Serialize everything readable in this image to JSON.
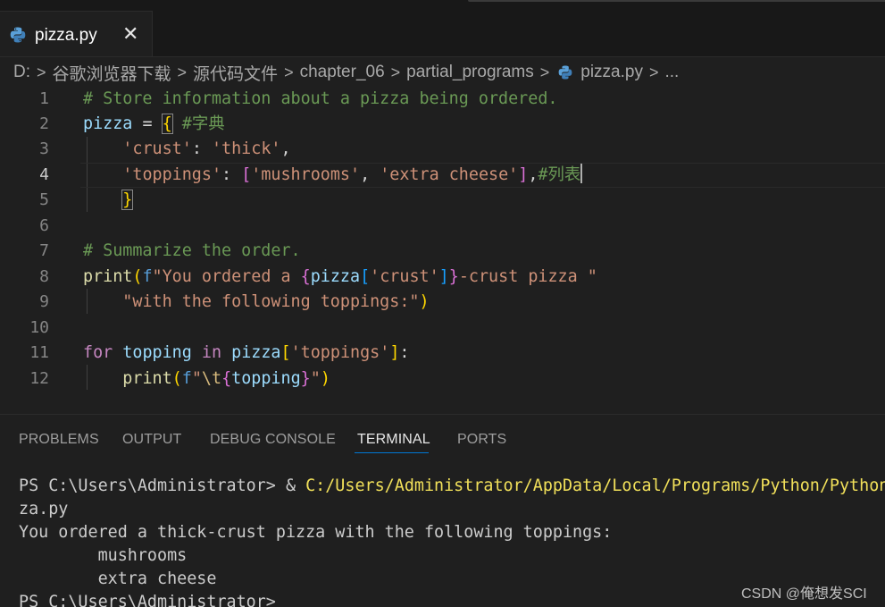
{
  "tab": {
    "title": "pizza.py",
    "close_glyph": "✕",
    "icon": "python-icon"
  },
  "breadcrumb": {
    "items": [
      "D:",
      "谷歌浏览器下载",
      "源代码文件",
      "chapter_06",
      "partial_programs",
      "pizza.py",
      "..."
    ],
    "separator": ">"
  },
  "editor": {
    "active_line": 4,
    "line_numbers": [
      "1",
      "2",
      "3",
      "4",
      "5",
      "6",
      "7",
      "8",
      "9",
      "10",
      "11",
      "12"
    ],
    "lines": [
      "# Store information about a pizza being ordered.",
      "pizza = { #字典",
      "    'crust': 'thick',",
      "    'toppings': ['mushrooms', 'extra cheese'],#列表",
      "    }",
      "",
      "# Summarize the order.",
      "print(f\"You ordered a {pizza['crust']}-crust pizza \"",
      "    \"with the following toppings:\")",
      "",
      "for topping in pizza['toppings']:",
      "    print(f\"\\t{topping}\")"
    ]
  },
  "panel": {
    "tabs": [
      "PROBLEMS",
      "OUTPUT",
      "DEBUG CONSOLE",
      "TERMINAL",
      "PORTS"
    ],
    "active_tab": "TERMINAL"
  },
  "terminal": {
    "prompt": "PS C:\\Users\\Administrator> & ",
    "command_path": "C:/Users/Administrator/AppData/Local/Programs/Python/Python",
    "wrap": "za.py",
    "output": [
      "You ordered a thick-crust pizza with the following toppings:",
      "        mushrooms",
      "        extra cheese"
    ],
    "last_prompt": "PS C:\\Users\\Administrator>"
  },
  "watermark": "CSDN @俺想发SCI",
  "colors": {
    "background": "#1f1f1f",
    "comment": "#6a9955",
    "variable": "#9cdcfe",
    "string": "#ce9178",
    "keyword": "#c586c0",
    "function": "#dcdcaa",
    "bracket_gold": "#ffd700",
    "bracket_orchid": "#da70d6",
    "bracket_blue": "#179fff",
    "accent": "#0078d4"
  }
}
